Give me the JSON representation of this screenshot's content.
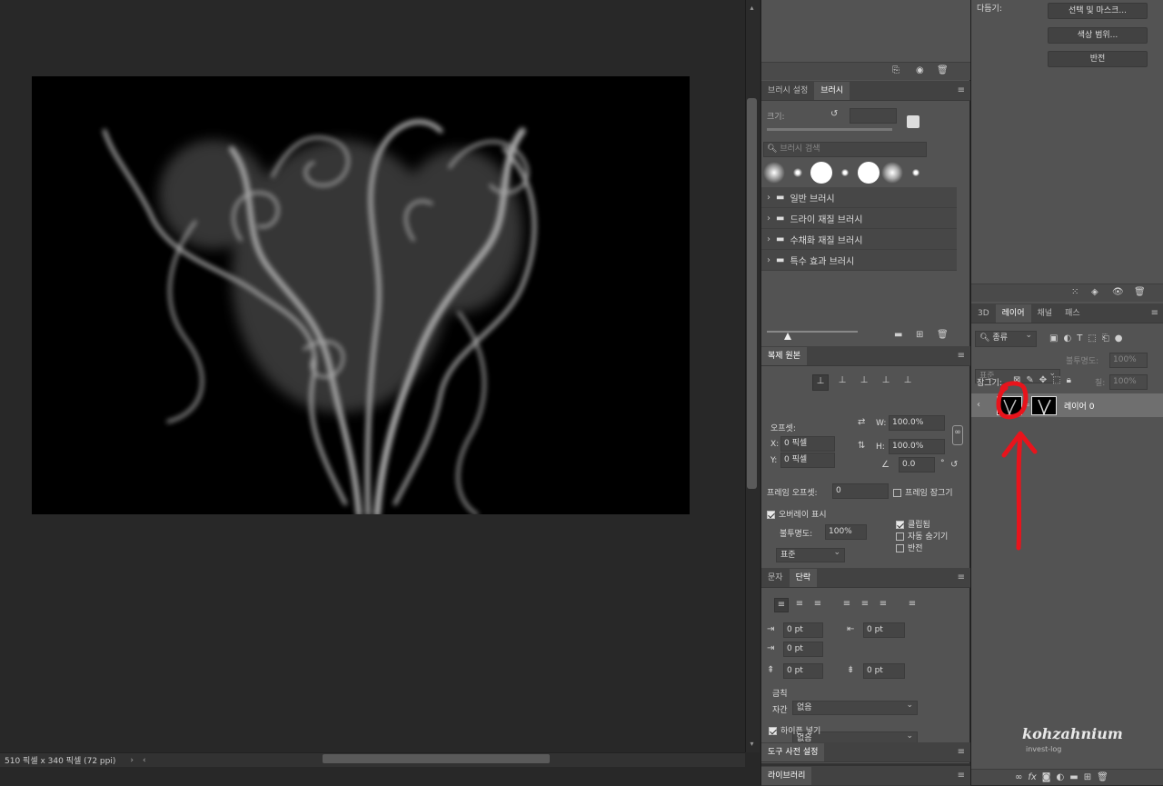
{
  "status": {
    "doc_info": "510 픽셀 x 340 픽셀 (72 ppi)",
    "nav_right": "›",
    "nav_left": "‹"
  },
  "brush_panel": {
    "tabs": [
      "브러시 설정",
      "브러시"
    ],
    "size_label": "크기:",
    "search_placeholder": "브러시 검색",
    "folders": [
      "일반 브러시",
      "드라이 재질 브러시",
      "수채화 재질 브러시",
      "특수 효과 브러시"
    ]
  },
  "clone_panel": {
    "tab": "복제 원본",
    "offset_label": "오프셋:",
    "x_label": "X:",
    "x_value": "0 픽셀",
    "y_label": "Y:",
    "y_value": "0 픽셀",
    "w_label": "W:",
    "w_value": "100.0%",
    "h_label": "H:",
    "h_value": "100.0%",
    "angle_value": "0.0",
    "degree": "°",
    "frame_offset_label": "프레임 오프셋:",
    "frame_offset_value": "0",
    "frame_lock_label": "프레임 잠그기",
    "overlay_label": "오버레이 표시",
    "opacity_label": "불투명도:",
    "opacity_value": "100%",
    "clipped_label": "클립됨",
    "auto_hide_label": "자동 숨기기",
    "invert_label": "반전",
    "blend_mode": "표준"
  },
  "paragraph_panel": {
    "tabs": [
      "문자",
      "단락"
    ],
    "indent_left": "0 pt",
    "indent_right": "0 pt",
    "indent_first": "0 pt",
    "space_before": "0 pt",
    "space_after": "0 pt",
    "kinsoku_label": "금칙",
    "kinsoku_value": "없음",
    "mojikumi_label": "자간",
    "mojikumi_value": "없음",
    "hyphen_label": "하이픈 넣기"
  },
  "tool_presets": {
    "tab": "도구 사전 설정"
  },
  "libraries": {
    "tab": "라이브러리"
  },
  "properties": {
    "refine_label": "다듬기:",
    "buttons": [
      "선택 및 마스크...",
      "색상 범위...",
      "반전"
    ]
  },
  "layers_panel": {
    "tabs": [
      "3D",
      "레이어",
      "채널",
      "패스"
    ],
    "filter_kind": "종류",
    "blend_mode": "표준",
    "opacity_label": "불투명도:",
    "opacity_value": "100%",
    "lock_label": "잠그기:",
    "fill_label": "칠:",
    "fill_value": "100%",
    "layer_name": "레이어 0"
  },
  "watermark": {
    "line1": "kohzahnium",
    "line2": "invest-log"
  },
  "colors": {
    "annotation_red": "#e8141c",
    "canvas_bg": "#282828",
    "panel_bg": "#535353"
  }
}
